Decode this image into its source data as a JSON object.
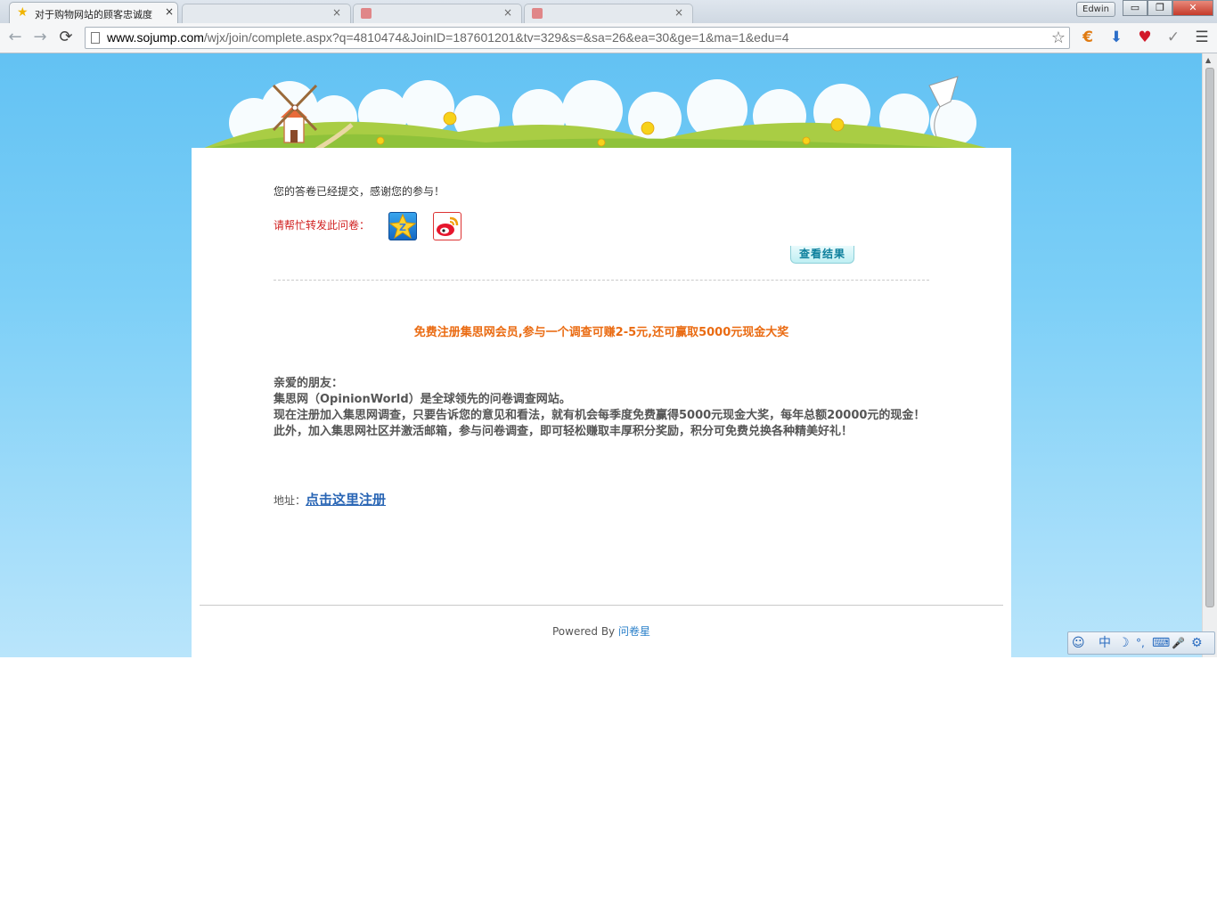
{
  "browser": {
    "active_tab_title": "对于购物网站的顾客忠诚度",
    "other_tabs": [
      "",
      "",
      ""
    ],
    "user_badge": "Edwin",
    "url_host": "www.sojump.com",
    "url_path": "/wjx/join/complete.aspx?q=4810474&JoinID=187601201&tv=329&s=&sa=26&ea=30&ge=1&ma=1&edu=4",
    "tab_close_glyph": "×",
    "window_buttons": {
      "minimize": "▭",
      "restore": "❐",
      "close": "✕"
    }
  },
  "icons": {
    "back": "←",
    "forward": "→",
    "reload": "⟳",
    "bookmark_star": "☆",
    "ext_currency": "€",
    "ext_download": "⬇",
    "ext_heart": "♥",
    "ext_check": "✓",
    "menu": "☰"
  },
  "page": {
    "submitted_message": "您的答卷已经提交，感谢您的参与！",
    "share_label": "请帮忙转发此问卷：",
    "view_results_label": "查看结果",
    "promo_text": "免费注册集思网会员,参与一个调查可赚2-5元,还可赢取5000元现金大奖",
    "letter": {
      "greeting": "亲爱的朋友：",
      "line1": "集思网（OpinionWorld）是全球领先的问卷调查网站。",
      "line2": "现在注册加入集思网调查，只要告诉您的意见和看法，就有机会每季度免费赢得5000元现金大奖，每年总额20000元的现金！",
      "line3": "此外，加入集思网社区并激活邮箱，参与问卷调查，即可轻松赚取丰厚积分奖励，积分可免费兑换各种精美好礼！"
    },
    "address_label": "地址：",
    "register_link": "点击这里注册",
    "footer_powered": "Powered By",
    "footer_brand": "问卷星"
  },
  "ime": {
    "logo": "☺",
    "mode_chinese": "中",
    "moon": "☽",
    "punct": "°,",
    "keyboard": "⌨",
    "mic": "🎤",
    "settings": "⚙"
  },
  "colors": {
    "sky_top": "#63c2f3",
    "promo_orange": "#ea6b12",
    "share_red": "#d12020",
    "link_blue": "#2a66b5"
  }
}
